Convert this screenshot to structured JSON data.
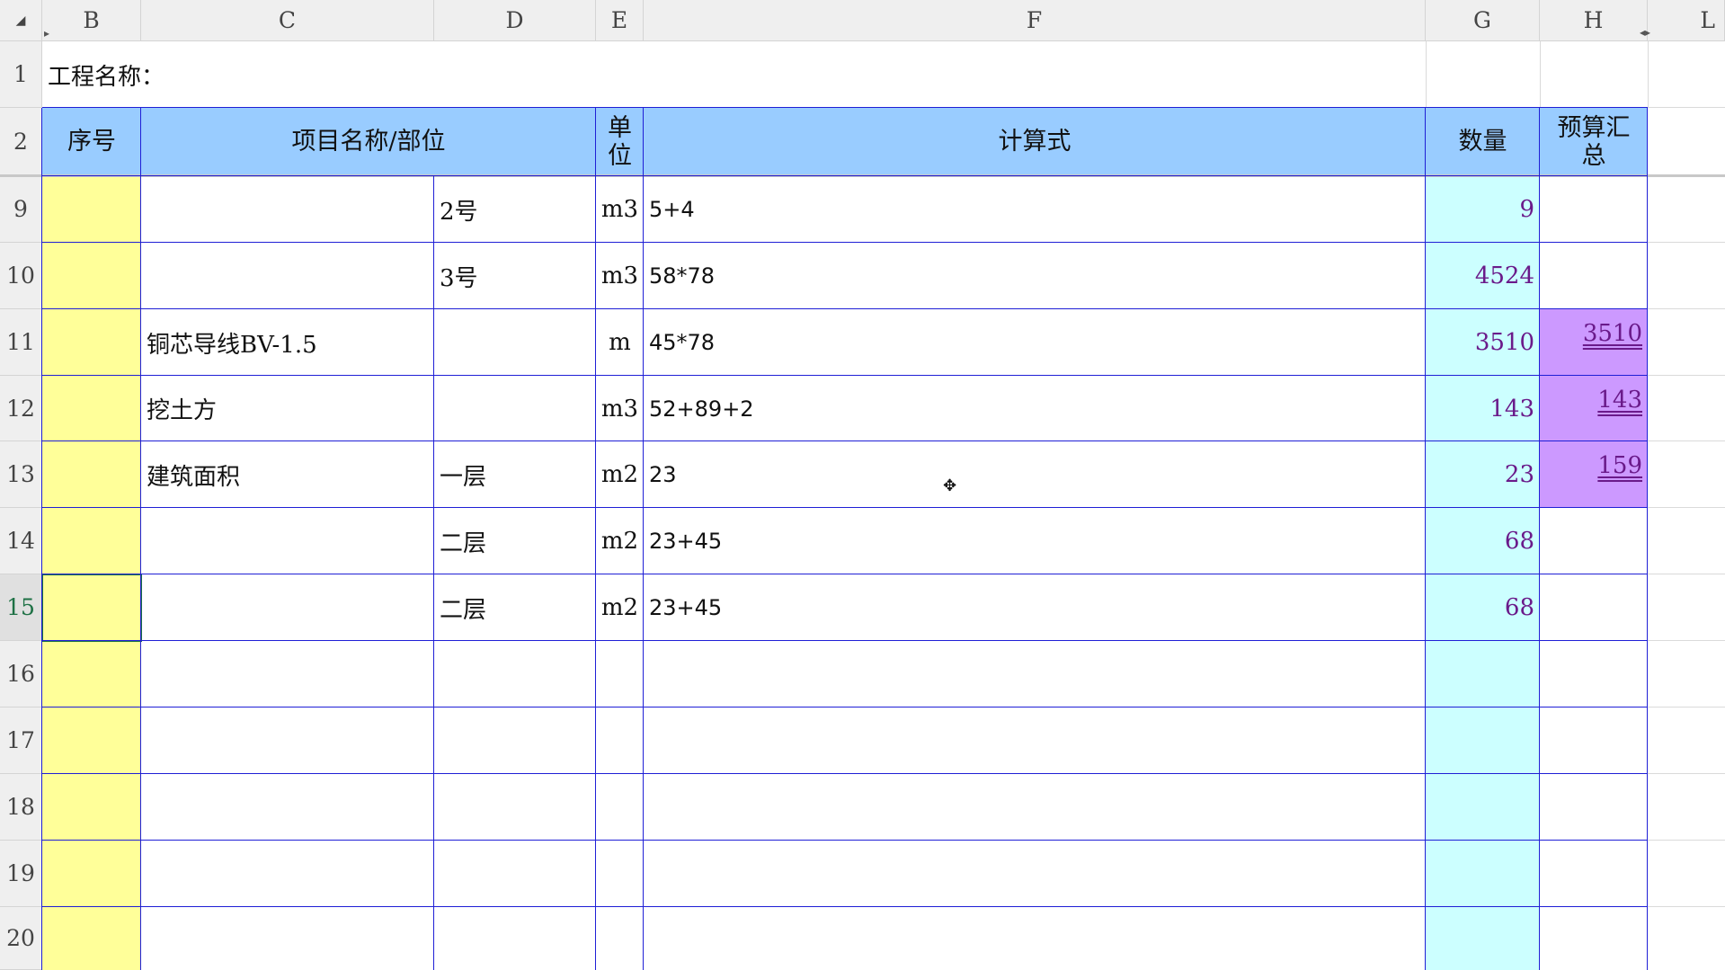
{
  "columns": [
    "B",
    "C",
    "D",
    "E",
    "F",
    "G",
    "H",
    "L"
  ],
  "row_numbers": [
    "1",
    "2",
    "9",
    "10",
    "11",
    "12",
    "13",
    "14",
    "15",
    "16",
    "17",
    "18",
    "19",
    "20"
  ],
  "title_cell": "工程名称：",
  "headers": {
    "seq": "序号",
    "item": "项目名称/部位",
    "unit": "单位",
    "formula": "计算式",
    "qty": "数量",
    "budget": "预算汇总"
  },
  "rows": [
    {
      "row": "9",
      "item": "",
      "part": "2号",
      "unit": "m3",
      "formula": "5+4",
      "qty": "9",
      "budget": ""
    },
    {
      "row": "10",
      "item": "",
      "part": "3号",
      "unit": "m3",
      "formula": "58*78",
      "qty": "4524",
      "budget": ""
    },
    {
      "row": "11",
      "item": "铜芯导线BV-1.5",
      "part": "",
      "unit": "m",
      "formula": "45*78",
      "qty": "3510",
      "budget": "3510"
    },
    {
      "row": "12",
      "item": "挖土方",
      "part": "",
      "unit": "m3",
      "formula": "52+89+2",
      "qty": "143",
      "budget": "143"
    },
    {
      "row": "13",
      "item": "建筑面积",
      "part": "一层",
      "unit": "m2",
      "formula": "23",
      "qty": "23",
      "budget": "159"
    },
    {
      "row": "14",
      "item": "",
      "part": "二层",
      "unit": "m2",
      "formula": "23+45",
      "qty": "68",
      "budget": ""
    },
    {
      "row": "15",
      "item": "",
      "part": "二层",
      "unit": "m2",
      "formula": "23+45",
      "qty": "68",
      "budget": ""
    },
    {
      "row": "16",
      "item": "",
      "part": "",
      "unit": "",
      "formula": "",
      "qty": "",
      "budget": ""
    },
    {
      "row": "17",
      "item": "",
      "part": "",
      "unit": "",
      "formula": "",
      "qty": "",
      "budget": ""
    },
    {
      "row": "18",
      "item": "",
      "part": "",
      "unit": "",
      "formula": "",
      "qty": "",
      "budget": ""
    },
    {
      "row": "19",
      "item": "",
      "part": "",
      "unit": "",
      "formula": "",
      "qty": "",
      "budget": ""
    },
    {
      "row": "20",
      "item": "",
      "part": "",
      "unit": "",
      "formula": "",
      "qty": "",
      "budget": ""
    }
  ],
  "active_row": "15",
  "colors": {
    "header_fill": "#99ccff",
    "seq_fill": "#ffff99",
    "qty_fill": "#ccffff",
    "budget_fill": "#cc99ff",
    "border": "#1f1fd6",
    "number_text": "#6a1a8a"
  }
}
